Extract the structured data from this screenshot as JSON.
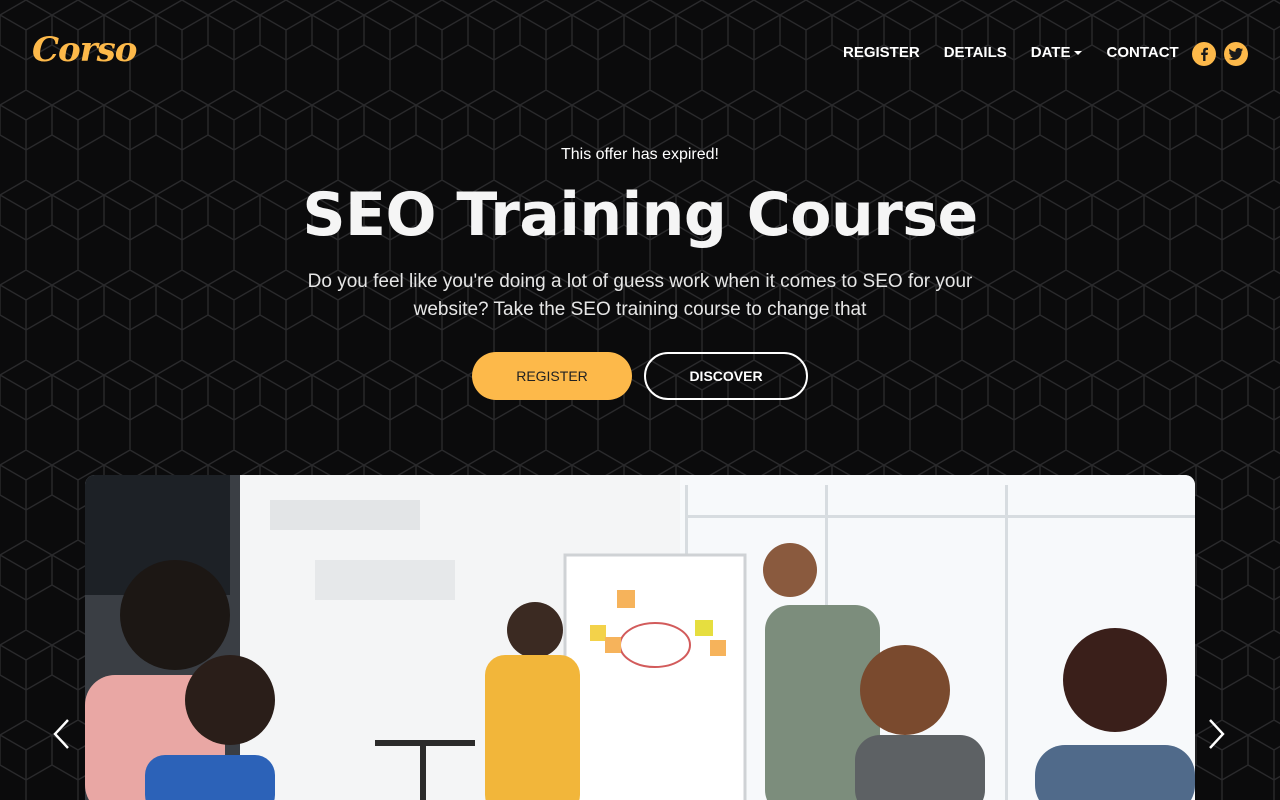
{
  "brand": {
    "logo_text": "Corso",
    "accent_color": "#fdb94a"
  },
  "nav": {
    "items": [
      {
        "label": "REGISTER"
      },
      {
        "label": "DETAILS"
      },
      {
        "label": "DATE",
        "has_dropdown": true
      },
      {
        "label": "CONTACT"
      }
    ],
    "social": [
      {
        "icon": "facebook-icon"
      },
      {
        "icon": "twitter-icon"
      }
    ]
  },
  "hero": {
    "notice": "This offer has expired!",
    "title": "SEO Training Course",
    "subtitle": "Do you feel like you're doing a lot of guess work when it comes to SEO for your website? Take the SEO training course to change that",
    "primary_button": "REGISTER",
    "secondary_button": "DISCOVER"
  },
  "carousel": {
    "prev_icon": "chevron-left-icon",
    "next_icon": "chevron-right-icon",
    "image_icon": "training-photo"
  }
}
